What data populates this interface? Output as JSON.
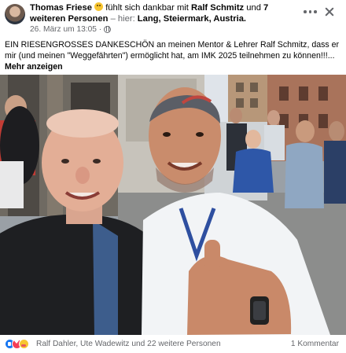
{
  "header": {
    "author": "Thomas Friese",
    "feeling_text": "fühlt sich dankbar mit",
    "tagged_person": "Ralf Schmitz",
    "and_text": "und",
    "others_text": "7 weiteren Personen",
    "location_prefix": "– hier:",
    "location": "Lang, Steiermark, Austria.",
    "timestamp": "26. März um 13:05 ·",
    "privacy_icon": "globe-icon",
    "more_icon": "more-options-icon",
    "close_icon": "close-icon"
  },
  "post": {
    "text": "EIN RIESENGROSSES DANKESCHÖN an meinen Mentor & Lehrer Ralf Schmitz, dass er mir (und meinen \"Weggefährten\") ermöglicht hat, am IMK 2025 teilnehmen zu können!!!...",
    "see_more": "Mehr anzeigen"
  },
  "photo": {
    "description_icon": "photo-selfie"
  },
  "footer": {
    "reaction_icons": [
      "like-icon",
      "love-icon",
      "care-icon"
    ],
    "reaction_names": "Ralf Dahler, Ute Wadewitz und 22 weitere Personen",
    "comments": "1 Kommentar"
  },
  "colors": {
    "muted_text": "#65676b",
    "primary_text": "#050505",
    "like_blue": "#1877f2",
    "love_red": "#f33e58"
  }
}
